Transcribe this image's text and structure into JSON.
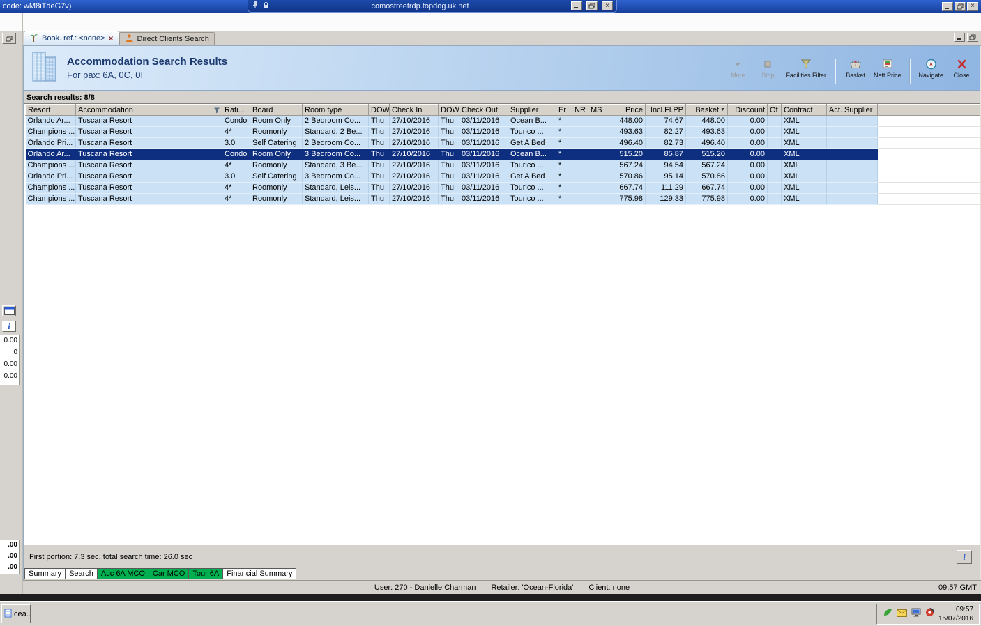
{
  "rdp": {
    "left_text": "code: wM8iTdeG7v)",
    "host": "comostreetrdp.topdog.uk.net"
  },
  "window": {
    "tabs": [
      {
        "label": "Book. ref.: <none>"
      },
      {
        "label": "Direct Clients Search"
      }
    ]
  },
  "header": {
    "title": "Accommodation Search Results",
    "subtitle": "For pax: 6A, 0C, 0I",
    "toolbar": [
      {
        "label": "More",
        "disabled": true
      },
      {
        "label": "Stop",
        "disabled": true
      },
      {
        "label": "Facilities Filter"
      },
      {
        "label": "Basket"
      },
      {
        "label": "Nett Price"
      },
      {
        "label": "Navigate"
      },
      {
        "label": "Close"
      }
    ]
  },
  "results": {
    "summary": "Search results: 8/8",
    "sort_column": "Basket",
    "selected_row_index": 3,
    "columns": [
      "Resort",
      "Accommodation",
      "Rati...",
      "Board",
      "Room type",
      "DOW",
      "Check In",
      "DOW",
      "Check Out",
      "Supplier",
      "Er",
      "NR",
      "MS",
      "Price",
      "Incl.Fl.PP",
      "Basket",
      "Discount",
      "Of",
      "Contract",
      "Act. Supplier"
    ],
    "rows": [
      [
        "Orlando Ar...",
        "Tuscana Resort",
        "Condo",
        "Room Only",
        "2 Bedroom Co...",
        "Thu",
        "27/10/2016",
        "Thu",
        "03/11/2016",
        "Ocean B...",
        "*",
        "",
        "",
        "448.00",
        "74.67",
        "448.00",
        "0.00",
        "",
        "XML",
        ""
      ],
      [
        "Champions ...",
        "Tuscana Resort",
        "4*",
        "Roomonly",
        "Standard, 2 Be...",
        "Thu",
        "27/10/2016",
        "Thu",
        "03/11/2016",
        "Tourico ...",
        "*",
        "",
        "",
        "493.63",
        "82.27",
        "493.63",
        "0.00",
        "",
        "XML",
        ""
      ],
      [
        "Orlando Pri...",
        "Tuscana Resort",
        "3.0",
        "Self Catering",
        "2 Bedroom Co...",
        "Thu",
        "27/10/2016",
        "Thu",
        "03/11/2016",
        "Get A Bed",
        "*",
        "",
        "",
        "496.40",
        "82.73",
        "496.40",
        "0.00",
        "",
        "XML",
        ""
      ],
      [
        "Orlando Ar...",
        "Tuscana Resort",
        "Condo",
        "Room Only",
        "3 Bedroom Co...",
        "Thu",
        "27/10/2016",
        "Thu",
        "03/11/2016",
        "Ocean B...",
        "*",
        "",
        "",
        "515.20",
        "85.87",
        "515.20",
        "0.00",
        "",
        "XML",
        ""
      ],
      [
        "Champions ...",
        "Tuscana Resort",
        "4*",
        "Roomonly",
        "Standard, 3 Be...",
        "Thu",
        "27/10/2016",
        "Thu",
        "03/11/2016",
        "Tourico ...",
        "*",
        "",
        "",
        "567.24",
        "94.54",
        "567.24",
        "0.00",
        "",
        "XML",
        ""
      ],
      [
        "Orlando Pri...",
        "Tuscana Resort",
        "3.0",
        "Self Catering",
        "3 Bedroom Co...",
        "Thu",
        "27/10/2016",
        "Thu",
        "03/11/2016",
        "Get A Bed",
        "*",
        "",
        "",
        "570.86",
        "95.14",
        "570.86",
        "0.00",
        "",
        "XML",
        ""
      ],
      [
        "Champions ...",
        "Tuscana Resort",
        "4*",
        "Roomonly",
        "Standard, Leis...",
        "Thu",
        "27/10/2016",
        "Thu",
        "03/11/2016",
        "Tourico ...",
        "*",
        "",
        "",
        "667.74",
        "111.29",
        "667.74",
        "0.00",
        "",
        "XML",
        ""
      ],
      [
        "Champions ...",
        "Tuscana Resort",
        "4*",
        "Roomonly",
        "Standard, Leis...",
        "Thu",
        "27/10/2016",
        "Thu",
        "03/11/2016",
        "Tourico ...",
        "*",
        "",
        "",
        "775.98",
        "129.33",
        "775.98",
        "0.00",
        "",
        "XML",
        ""
      ]
    ]
  },
  "footer": {
    "timing": "First portion: 7.3 sec, total search time: 26.0 sec",
    "info_label": "i",
    "tabs": [
      {
        "label": "Summary",
        "highlight": false
      },
      {
        "label": "Search",
        "highlight": false
      },
      {
        "label": "Acc 6A MCO",
        "highlight": true
      },
      {
        "label": "Car MCO",
        "highlight": true
      },
      {
        "label": "Tour 6A",
        "highlight": true
      },
      {
        "label": "Financial Summary",
        "highlight": false
      }
    ],
    "status": {
      "user": "User: 270 - Danielle Charman",
      "retailer": "Retailer: 'Ocean-Florida'",
      "client": "Client: none",
      "time": "09:57 GMT"
    }
  },
  "taskbar": {
    "app_button": "cea...",
    "clock_time": "09:57",
    "clock_date": "15/07/2016"
  },
  "left_edge": {
    "info_label": "i",
    "top_values": [
      "0.00",
      "0",
      "0.00",
      "0.00"
    ],
    "bottom_values": [
      ".00",
      ".00",
      ".00"
    ]
  }
}
